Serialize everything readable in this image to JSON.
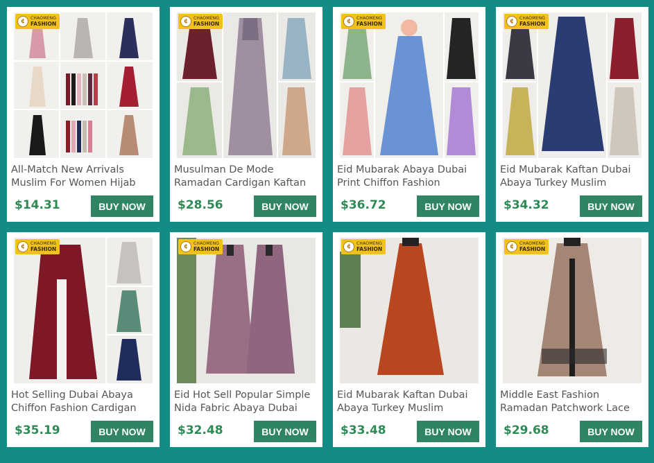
{
  "brand": {
    "badge_top": "CHAOMENG",
    "badge_bottom": "FASHION"
  },
  "buy_label": "BUY NOW",
  "colors": {
    "background": "#138c87",
    "button": "#2f8563",
    "price": "#2e8a55",
    "badge": "#f1c21b"
  },
  "products": [
    {
      "title_line1": "All-Match New Arrivals",
      "title_line2": "Muslim For Women Hijab",
      "price": "$14.31",
      "image": "collage-abaya-colors"
    },
    {
      "title_line1": "Musulman De Mode",
      "title_line2": "Ramadan Cardigan Kaftan",
      "price": "$28.56",
      "image": "satin-kaftan-collage"
    },
    {
      "title_line1": "Eid Mubarak Abaya Dubai",
      "title_line2": "Print Chiffon Fashion",
      "price": "$36.72",
      "image": "print-chiffon-collage"
    },
    {
      "title_line1": "Eid Mubarak Kaftan Dubai",
      "title_line2": "Abaya Turkey Muslim",
      "price": "$34.32",
      "image": "floral-dress-collage"
    },
    {
      "title_line1": "Hot Selling Dubai Abaya",
      "title_line2": "Chiffon Fashion Cardigan",
      "price": "$35.19",
      "image": "burgundy-cardigan-collage"
    },
    {
      "title_line1": "Eid Hot Sell Popular Simple",
      "title_line2": "Nida Fabric Abaya Dubai",
      "price": "$32.48",
      "image": "mauve-abaya-pair"
    },
    {
      "title_line1": "Eid Mubarak Kaftan Dubai",
      "title_line2": "Abaya Turkey Muslim",
      "price": "$33.48",
      "image": "rust-ruffle-dress"
    },
    {
      "title_line1": "Middle East Fashion",
      "title_line2": "Ramadan Patchwork Lace",
      "price": "$29.68",
      "image": "taupe-lace-abaya"
    }
  ]
}
